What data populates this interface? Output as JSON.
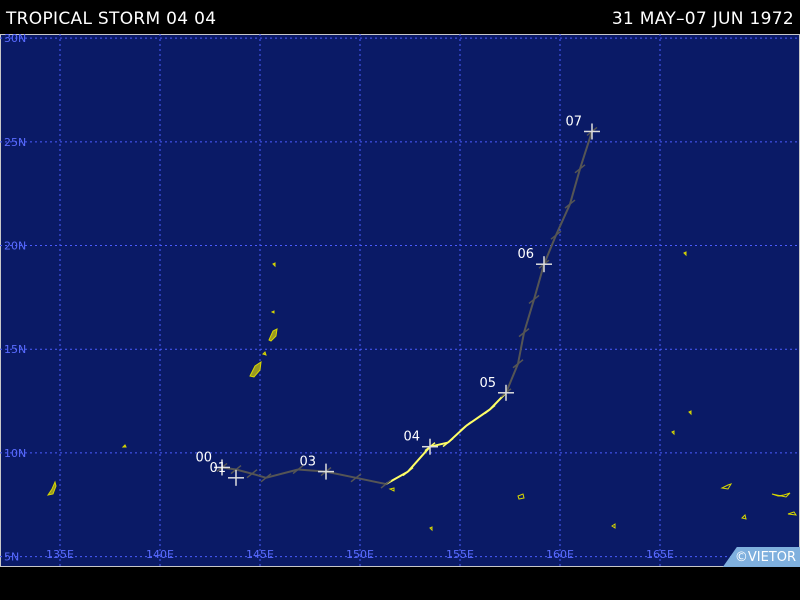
{
  "header": {
    "title": "TROPICAL STORM 04 04",
    "dates": "31 MAY–07 JUN 1972"
  },
  "credit": "©VIETOR",
  "colors": {
    "ocean": "#0a1a66",
    "grid": "#4a5cff",
    "axis_label": "#5a6cff",
    "land": "#9a9a20",
    "track_storm": "#ffff66",
    "track_weak": "#555555",
    "day_label": "#ffffff",
    "credit_bg": "#7fb0de"
  },
  "map": {
    "lon_labels": [
      "135E",
      "140E",
      "145E",
      "150E",
      "155E",
      "160E",
      "165E"
    ],
    "lat_labels": [
      "30N",
      "25N",
      "20N",
      "15N",
      "10N",
      "5N"
    ],
    "lon_range": [
      132,
      172
    ],
    "lat_range": [
      4.5,
      30.2
    ]
  },
  "track": {
    "points": [
      {
        "lat": 9.3,
        "lon": 143.1,
        "i": "weak"
      },
      {
        "lat": 9.2,
        "lon": 143.8,
        "i": "weak"
      },
      {
        "lat": 9.0,
        "lon": 144.6,
        "i": "weak"
      },
      {
        "lat": 8.8,
        "lon": 145.3,
        "i": "weak"
      },
      {
        "lat": 9.2,
        "lon": 146.9,
        "i": "weak"
      },
      {
        "lat": 9.1,
        "lon": 148.3,
        "i": "weak"
      },
      {
        "lat": 8.8,
        "lon": 149.8,
        "i": "weak"
      },
      {
        "lat": 8.5,
        "lon": 151.3,
        "i": "weak"
      },
      {
        "lat": 9.1,
        "lon": 152.4,
        "i": "storm"
      },
      {
        "lat": 10.3,
        "lon": 153.5,
        "i": "storm"
      },
      {
        "lat": 10.5,
        "lon": 154.4,
        "i": "storm"
      },
      {
        "lat": 11.3,
        "lon": 155.3,
        "i": "storm"
      },
      {
        "lat": 12.1,
        "lon": 156.5,
        "i": "storm"
      },
      {
        "lat": 12.9,
        "lon": 157.3,
        "i": "weak"
      },
      {
        "lat": 14.3,
        "lon": 157.9,
        "i": "weak"
      },
      {
        "lat": 15.8,
        "lon": 158.2,
        "i": "weak"
      },
      {
        "lat": 17.4,
        "lon": 158.7,
        "i": "weak"
      },
      {
        "lat": 19.1,
        "lon": 159.2,
        "i": "weak"
      },
      {
        "lat": 20.5,
        "lon": 159.8,
        "i": "weak"
      },
      {
        "lat": 22.0,
        "lon": 160.5,
        "i": "weak"
      },
      {
        "lat": 23.7,
        "lon": 161.0,
        "i": "weak"
      },
      {
        "lat": 25.5,
        "lon": 161.6,
        "i": "weak"
      }
    ],
    "day_labels": [
      {
        "text": "00",
        "lat": 9.3,
        "lon": 143.1
      },
      {
        "text": "01",
        "lat": 8.8,
        "lon": 143.8
      },
      {
        "text": "03",
        "lat": 9.1,
        "lon": 148.3
      },
      {
        "text": "04",
        "lat": 10.3,
        "lon": 153.5
      },
      {
        "text": "05",
        "lat": 12.9,
        "lon": 157.3
      },
      {
        "text": "06",
        "lat": 19.1,
        "lon": 159.2
      },
      {
        "text": "07",
        "lat": 25.5,
        "lon": 161.6
      }
    ]
  }
}
